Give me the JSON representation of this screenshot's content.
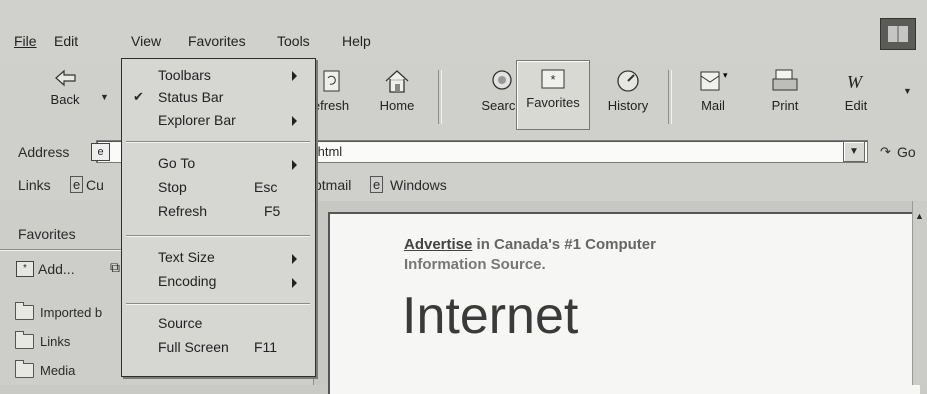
{
  "menubar": {
    "items": [
      "File",
      "Edit",
      "View",
      "Favorites",
      "Tools",
      "Help"
    ]
  },
  "toolbar": {
    "back": "Back",
    "refresh": "efresh",
    "home": "Home",
    "search": "Search",
    "favorites": "Favorites",
    "history": "History",
    "mail": "Mail",
    "print": "Print",
    "edit": "Edit"
  },
  "address": {
    "label": "Address",
    "value": ".html",
    "go": "Go"
  },
  "links": {
    "label": "Links",
    "item1": "Cu",
    "item2": "otmail",
    "item3": "Windows"
  },
  "favorites_pane": {
    "title": "Favorites",
    "add": "Add...",
    "items": [
      "Imported b",
      "Links",
      "Media"
    ]
  },
  "view_menu": {
    "toolbars": "Toolbars",
    "status_bar": "Status Bar",
    "explorer_bar": "Explorer Bar",
    "go_to": "Go To",
    "stop": "Stop",
    "stop_key": "Esc",
    "refresh": "Refresh",
    "refresh_key": "F5",
    "text_size": "Text Size",
    "encoding": "Encoding",
    "source": "Source",
    "full_screen": "Full Screen",
    "full_screen_key": "F11",
    "check": "✔"
  },
  "page": {
    "advertise_link": "Advertise",
    "advertise_rest": " in Canada's #1 Computer",
    "advertise_line2": "Information Source.",
    "heading": "Internet"
  },
  "colors": {
    "chrome": "#cfcfcb",
    "menu_bg": "#d6d6d2",
    "page_bg": "#f6f6f4"
  }
}
